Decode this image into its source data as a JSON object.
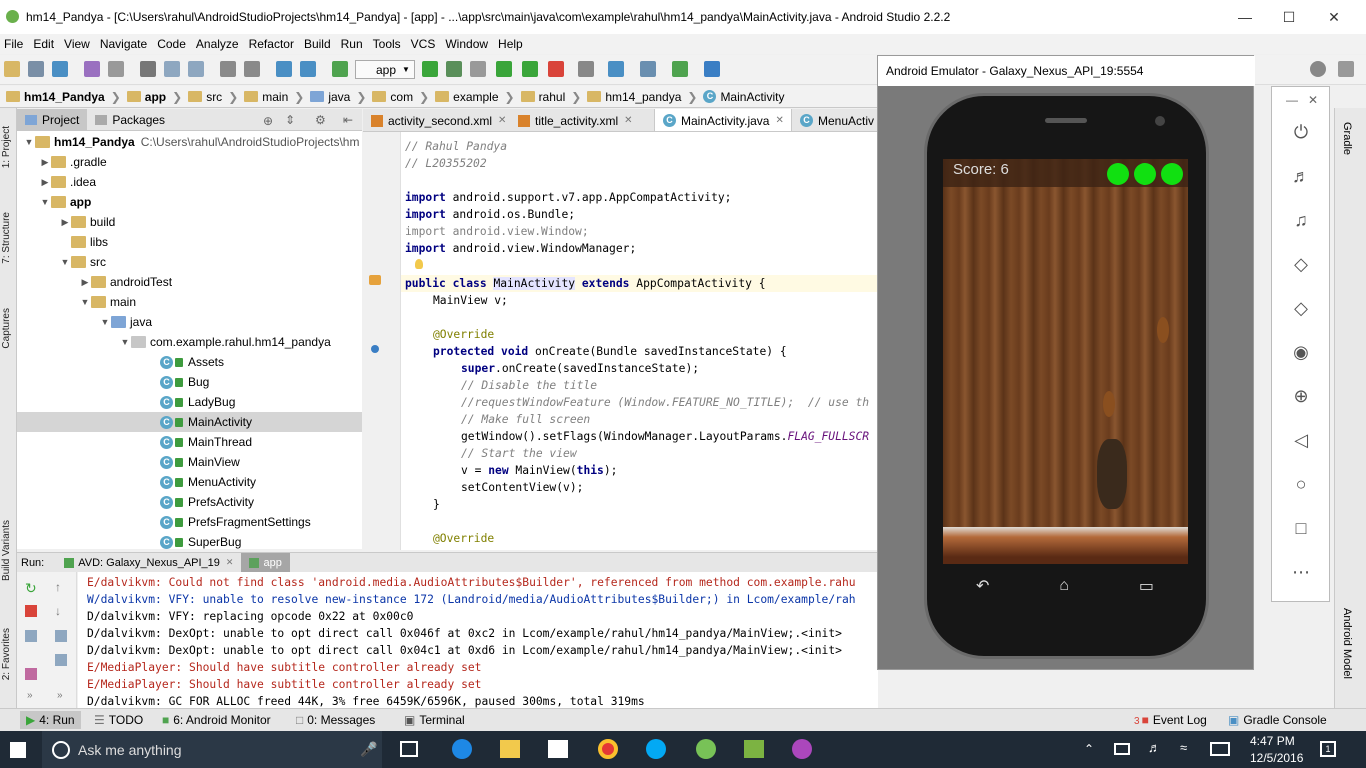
{
  "window": {
    "title": "hm14_Pandya - [C:\\Users\\rahul\\AndroidStudioProjects\\hm14_Pandya] - [app] - ...\\app\\src\\main\\java\\com\\example\\rahul\\hm14_pandya\\MainActivity.java - Android Studio 2.2.2"
  },
  "menu": [
    "File",
    "Edit",
    "View",
    "Navigate",
    "Code",
    "Analyze",
    "Refactor",
    "Build",
    "Run",
    "Tools",
    "VCS",
    "Window",
    "Help"
  ],
  "toolbar": {
    "run_config": "app"
  },
  "breadcrumb": [
    "hm14_Pandya",
    "app",
    "src",
    "main",
    "java",
    "com",
    "example",
    "rahul",
    "hm14_pandya",
    "MainActivity"
  ],
  "left_strip": {
    "project": "1: Project",
    "structure": "7: Structure",
    "captures": "Captures",
    "build_variants": "Build Variants",
    "favorites": "2: Favorites"
  },
  "project_panel": {
    "tabs": [
      "Project",
      "Packages"
    ],
    "root_name": "hm14_Pandya",
    "root_path": "C:\\Users\\rahul\\AndroidStudioProjects\\hm",
    "items": [
      ".gradle",
      ".idea",
      "app",
      "build",
      "libs",
      "src",
      "androidTest",
      "main",
      "java",
      "com.example.rahul.hm14_pandya",
      "Assets",
      "Bug",
      "LadyBug",
      "MainActivity",
      "MainThread",
      "MainView",
      "MenuActivity",
      "PrefsActivity",
      "PrefsFragmentSettings",
      "SuperBug"
    ]
  },
  "editor_tabs": [
    "activity_second.xml",
    "title_activity.xml",
    "MainActivity.java",
    "MenuActiv"
  ],
  "code": {
    "l1": "// Rahul Pandya",
    "l2": "// L20355202",
    "l3": "android.support.v7.app.AppCompatActivity;",
    "l4": "android.os.Bundle;",
    "l5": "android.view.Window;",
    "l6": "android.view.WindowManager;",
    "import_kw": "import",
    "class_kw": "public class",
    "class_name": "MainActivity",
    "extends_kw": "extends",
    "class_tail": "AppCompatActivity {",
    "l8": "MainView v;",
    "override": "@Override",
    "proto_kw": "protected void",
    "proto_tail": "onCreate(Bundle savedInstanceState) {",
    "super_kw": "super",
    "super_tail": ".onCreate(savedInstanceState);",
    "c1": "// Disable the title",
    "c2": "//requestWindowFeature (Window.FEATURE_NO_TITLE);  // use th",
    "c3": "// Make full screen",
    "flags_head": "getWindow().setFlags(WindowManager.LayoutParams.",
    "flags_field": "FLAG_FULLSCR",
    "c4": "// Start the view",
    "v_head": "v = ",
    "new_kw": "new",
    "v_mid": " MainView(",
    "this_kw": "this",
    "v_tail": ");",
    "setcv": "setContentView(v);",
    "brace": "}",
    "override2": "@Override"
  },
  "run_bar": {
    "label": "Run:",
    "avd": "AVD: Galaxy_Nexus_API_19",
    "app": "app"
  },
  "console": [
    {
      "type": "err",
      "text": "E/dalvikvm: Could not find class 'android.media.AudioAttributes$Builder', referenced from method com.example.rahu"
    },
    {
      "type": "warn",
      "text": "W/dalvikvm: VFY: unable to resolve new-instance 172 (Landroid/media/AudioAttributes$Builder;) in Lcom/example/rah"
    },
    {
      "type": "dbg",
      "text": "D/dalvikvm: VFY: replacing opcode 0x22 at 0x00c0"
    },
    {
      "type": "dbg",
      "text": "D/dalvikvm: DexOpt: unable to opt direct call 0x046f at 0xc2 in Lcom/example/rahul/hm14_pandya/MainView;.<init>"
    },
    {
      "type": "dbg",
      "text": "D/dalvikvm: DexOpt: unable to opt direct call 0x04c1 at 0xd6 in Lcom/example/rahul/hm14_pandya/MainView;.<init>"
    },
    {
      "type": "err",
      "text": "E/MediaPlayer: Should have subtitle controller already set"
    },
    {
      "type": "err",
      "text": "E/MediaPlayer: Should have subtitle controller already set"
    },
    {
      "type": "dbg",
      "text": "D/dalvikvm: GC FOR ALLOC freed 44K, 3% free 6459K/6596K, paused 300ms, total 319ms"
    }
  ],
  "bottom_tabs": {
    "run": "4: Run",
    "todo": "TODO",
    "monitor": "6: Android Monitor",
    "messages": "0: Messages",
    "terminal": "Terminal",
    "event_log": "Event Log",
    "event_count": "3",
    "gradle_console": "Gradle Console"
  },
  "emulator": {
    "title": "Android Emulator - Galaxy_Nexus_API_19:5554",
    "score": "Score: 6"
  },
  "right_strip": {
    "gradle": "Gradle",
    "android_model": "Android Model"
  },
  "taskbar": {
    "search": "Ask me anything",
    "time": "4:47 PM",
    "date": "12/5/2016",
    "notif_count": "1"
  }
}
